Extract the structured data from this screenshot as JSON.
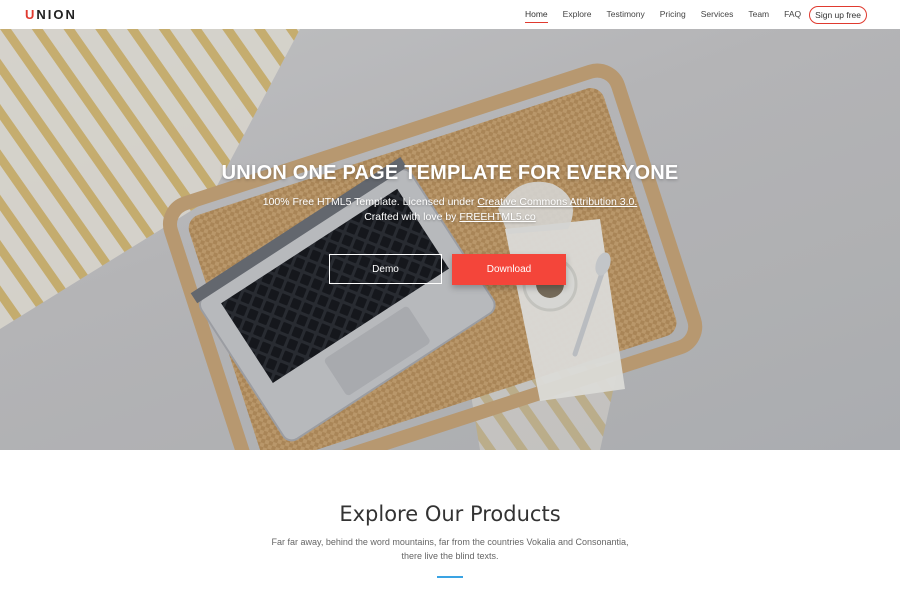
{
  "brand": {
    "logo_first": "U",
    "logo_rest": "NION"
  },
  "nav": {
    "items": [
      {
        "label": "Home",
        "active": true
      },
      {
        "label": "Explore"
      },
      {
        "label": "Testimony"
      },
      {
        "label": "Pricing"
      },
      {
        "label": "Services"
      },
      {
        "label": "Team"
      },
      {
        "label": "FAQ"
      }
    ],
    "signup_label": "Sign up free"
  },
  "hero": {
    "title": "UNION ONE PAGE TEMPLATE FOR EVERYONE",
    "line1_prefix": "100% Free HTML5 Template. Licensed under ",
    "line1_link": "Creative Commons Attribution 3.0.",
    "line2_prefix": "Crafted with love by ",
    "line2_link": "FREEHTML5.co",
    "demo_label": "Demo",
    "download_label": "Download"
  },
  "products": {
    "title": "Explore Our Products",
    "description": "Far far away, behind the word mountains, far from the countries Vokalia and Consonantia, there live the blind texts."
  },
  "colors": {
    "accent": "#e03a2f",
    "download_bg": "#f4453a",
    "rule": "#3aa3e3"
  }
}
